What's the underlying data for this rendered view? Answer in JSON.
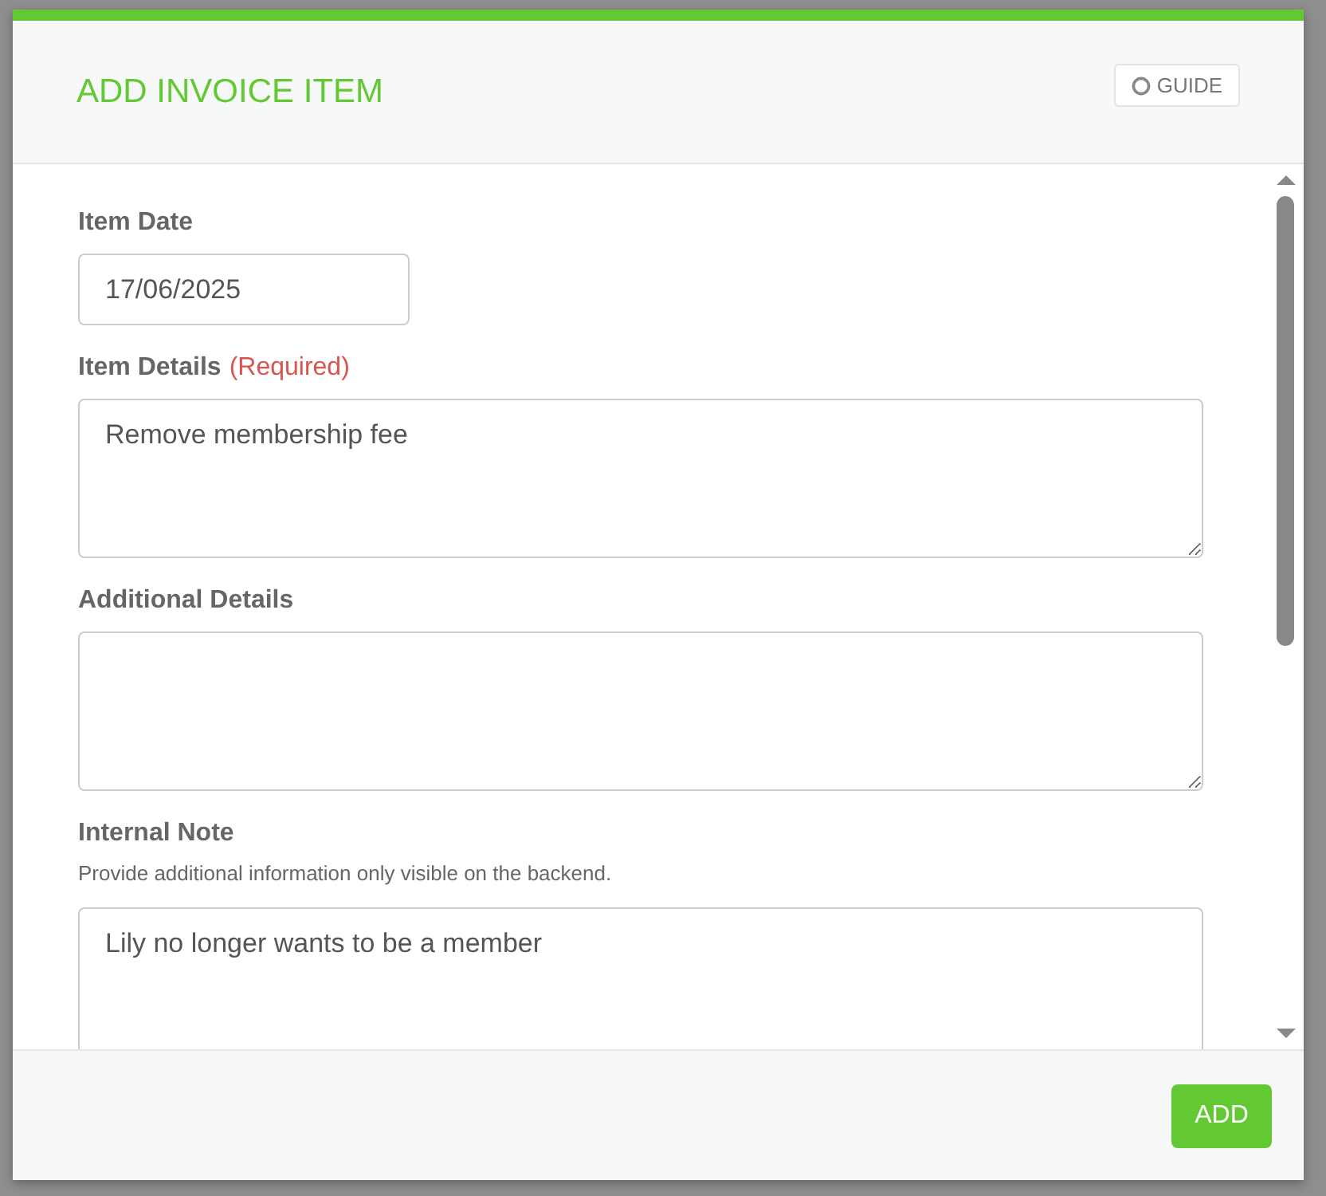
{
  "modal": {
    "title": "ADD INVOICE ITEM",
    "guide_button": "GUIDE"
  },
  "fields": [
    {
      "kind": "input",
      "label": "Item Date",
      "value": "17/06/2025"
    },
    {
      "kind": "textarea",
      "label": "Item Details",
      "required": "(Required)",
      "value": "Remove membership fee"
    },
    {
      "kind": "textarea",
      "label": "Additional Details"
    },
    {
      "kind": "textarea",
      "label": "Internal Note",
      "help": "Provide additional information only visible on the backend.",
      "value": "Lily no longer wants to be a member"
    }
  ],
  "footer": {
    "add_button": "ADD"
  }
}
